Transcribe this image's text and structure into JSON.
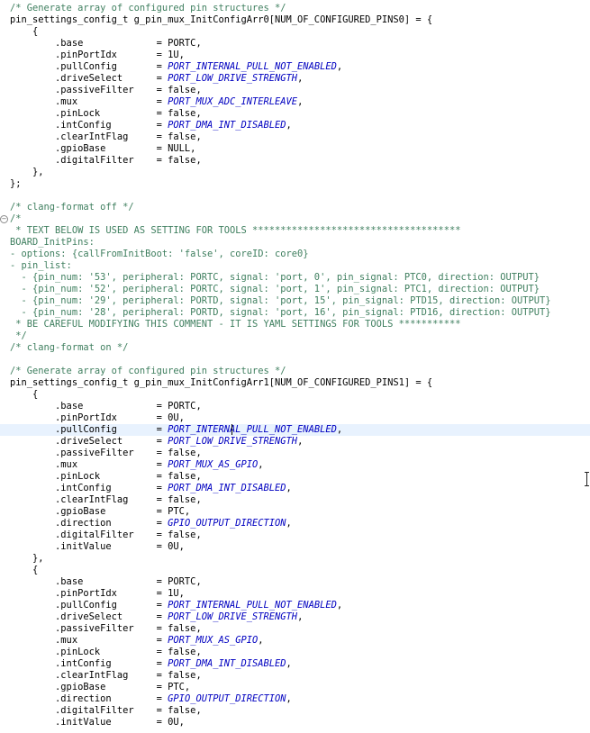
{
  "editor": {
    "code_lines": [
      [
        [
          "c",
          "/* Generate array of configured pin structures */"
        ]
      ],
      [
        [
          "p",
          "pin_settings_config_t g_pin_mux_InitConfigArr0[NUM_OF_CONFIGURED_PINS0] = {"
        ]
      ],
      [
        [
          "p",
          "    {"
        ]
      ],
      [
        [
          "p",
          "        .base             = PORTC,"
        ]
      ],
      [
        [
          "p",
          "        .pinPortIdx       = 1U,"
        ]
      ],
      [
        [
          "p",
          "        .pullConfig       = "
        ],
        [
          "e",
          "PORT_INTERNAL_PULL_NOT_ENABLED"
        ],
        [
          "p",
          ","
        ]
      ],
      [
        [
          "p",
          "        .driveSelect      = "
        ],
        [
          "e",
          "PORT_LOW_DRIVE_STRENGTH"
        ],
        [
          "p",
          ","
        ]
      ],
      [
        [
          "p",
          "        .passiveFilter    = false,"
        ]
      ],
      [
        [
          "p",
          "        .mux              = "
        ],
        [
          "e",
          "PORT_MUX_ADC_INTERLEAVE"
        ],
        [
          "p",
          ","
        ]
      ],
      [
        [
          "p",
          "        .pinLock          = false,"
        ]
      ],
      [
        [
          "p",
          "        .intConfig        = "
        ],
        [
          "e",
          "PORT_DMA_INT_DISABLED"
        ],
        [
          "p",
          ","
        ]
      ],
      [
        [
          "p",
          "        .clearIntFlag     = false,"
        ]
      ],
      [
        [
          "p",
          "        .gpioBase         = NULL,"
        ]
      ],
      [
        [
          "p",
          "        .digitalFilter    = false,"
        ]
      ],
      [
        [
          "p",
          "    },"
        ]
      ],
      [
        [
          "p",
          "};"
        ]
      ],
      [],
      [
        [
          "c",
          "/* clang-format off */"
        ]
      ],
      [
        [
          "c",
          "/*"
        ]
      ],
      [
        [
          "c",
          " * TEXT BELOW IS USED AS SETTING FOR TOOLS *************************************"
        ]
      ],
      [
        [
          "c",
          "BOARD_InitPins:"
        ]
      ],
      [
        [
          "c",
          "- options: {callFromInitBoot: 'false', coreID: core0}"
        ]
      ],
      [
        [
          "c",
          "- pin_list:"
        ]
      ],
      [
        [
          "c",
          "  - {pin_num: '53', peripheral: PORTC, signal: 'port, 0', pin_signal: PTC0, direction: OUTPUT}"
        ]
      ],
      [
        [
          "c",
          "  - {pin_num: '52', peripheral: PORTC, signal: 'port, 1', pin_signal: PTC1, direction: OUTPUT}"
        ]
      ],
      [
        [
          "c",
          "  - {pin_num: '29', peripheral: PORTD, signal: 'port, 15', pin_signal: PTD15, direction: OUTPUT}"
        ]
      ],
      [
        [
          "c",
          "  - {pin_num: '28', peripheral: PORTD, signal: 'port, 16', pin_signal: PTD16, direction: OUTPUT}"
        ]
      ],
      [
        [
          "c",
          " * BE CAREFUL MODIFYING THIS COMMENT - IT IS YAML SETTINGS FOR TOOLS ***********"
        ]
      ],
      [
        [
          "c",
          " */"
        ]
      ],
      [
        [
          "c",
          "/* clang-format on */"
        ]
      ],
      [],
      [
        [
          "c",
          "/* Generate array of configured pin structures */"
        ]
      ],
      [
        [
          "p",
          "pin_settings_config_t g_pin_mux_InitConfigArr1[NUM_OF_CONFIGURED_PINS1] = {"
        ]
      ],
      [
        [
          "p",
          "    {"
        ]
      ],
      [
        [
          "p",
          "        .base             = PORTC,"
        ]
      ],
      [
        [
          "p",
          "        .pinPortIdx       = 0U,"
        ]
      ],
      [
        [
          "p",
          "        .pullConfig       = "
        ],
        [
          "e",
          "PORT_INTERNAL_PULL_NOT_ENABLED"
        ],
        [
          "p",
          ","
        ]
      ],
      [
        [
          "p",
          "        .driveSelect      = "
        ],
        [
          "e",
          "PORT_LOW_DRIVE_STRENGTH"
        ],
        [
          "p",
          ","
        ]
      ],
      [
        [
          "p",
          "        .passiveFilter    = false,"
        ]
      ],
      [
        [
          "p",
          "        .mux              = "
        ],
        [
          "e",
          "PORT_MUX_AS_GPIO"
        ],
        [
          "p",
          ","
        ]
      ],
      [
        [
          "p",
          "        .pinLock          = false,"
        ]
      ],
      [
        [
          "p",
          "        .intConfig        = "
        ],
        [
          "e",
          "PORT_DMA_INT_DISABLED"
        ],
        [
          "p",
          ","
        ]
      ],
      [
        [
          "p",
          "        .clearIntFlag     = false,"
        ]
      ],
      [
        [
          "p",
          "        .gpioBase         = PTC,"
        ]
      ],
      [
        [
          "p",
          "        .direction        = "
        ],
        [
          "e",
          "GPIO_OUTPUT_DIRECTION"
        ],
        [
          "p",
          ","
        ]
      ],
      [
        [
          "p",
          "        .digitalFilter    = false,"
        ]
      ],
      [
        [
          "p",
          "        .initValue        = 0U,"
        ]
      ],
      [
        [
          "p",
          "    },"
        ]
      ],
      [
        [
          "p",
          "    {"
        ]
      ],
      [
        [
          "p",
          "        .base             = PORTC,"
        ]
      ],
      [
        [
          "p",
          "        .pinPortIdx       = 1U,"
        ]
      ],
      [
        [
          "p",
          "        .pullConfig       = "
        ],
        [
          "e",
          "PORT_INTERNAL_PULL_NOT_ENABLED"
        ],
        [
          "p",
          ","
        ]
      ],
      [
        [
          "p",
          "        .driveSelect      = "
        ],
        [
          "e",
          "PORT_LOW_DRIVE_STRENGTH"
        ],
        [
          "p",
          ","
        ]
      ],
      [
        [
          "p",
          "        .passiveFilter    = false,"
        ]
      ],
      [
        [
          "p",
          "        .mux              = "
        ],
        [
          "e",
          "PORT_MUX_AS_GPIO"
        ],
        [
          "p",
          ","
        ]
      ],
      [
        [
          "p",
          "        .pinLock          = false,"
        ]
      ],
      [
        [
          "p",
          "        .intConfig        = "
        ],
        [
          "e",
          "PORT_DMA_INT_DISABLED"
        ],
        [
          "p",
          ","
        ]
      ],
      [
        [
          "p",
          "        .clearIntFlag     = false,"
        ]
      ],
      [
        [
          "p",
          "        .gpioBase         = PTC,"
        ]
      ],
      [
        [
          "p",
          "        .direction        = "
        ],
        [
          "e",
          "GPIO_OUTPUT_DIRECTION"
        ],
        [
          "p",
          ","
        ]
      ],
      [
        [
          "p",
          "        .digitalFilter    = false,"
        ]
      ],
      [
        [
          "p",
          "        .initValue        = 0U,"
        ]
      ]
    ],
    "highlighted_line_number": 37,
    "fold_marker_line_number": 19,
    "fold_marker_glyph": "⊖",
    "colors": {
      "background": "#ffffff",
      "comment": "#3f7f5f",
      "enum_constant": "#0000c0",
      "plain_text": "#000000",
      "current_line": "#e8f2fe"
    },
    "icons": {
      "fold_marker": "collapse-minus-icon",
      "mouse_cursor": "text-ibeam-cursor-icon"
    }
  }
}
